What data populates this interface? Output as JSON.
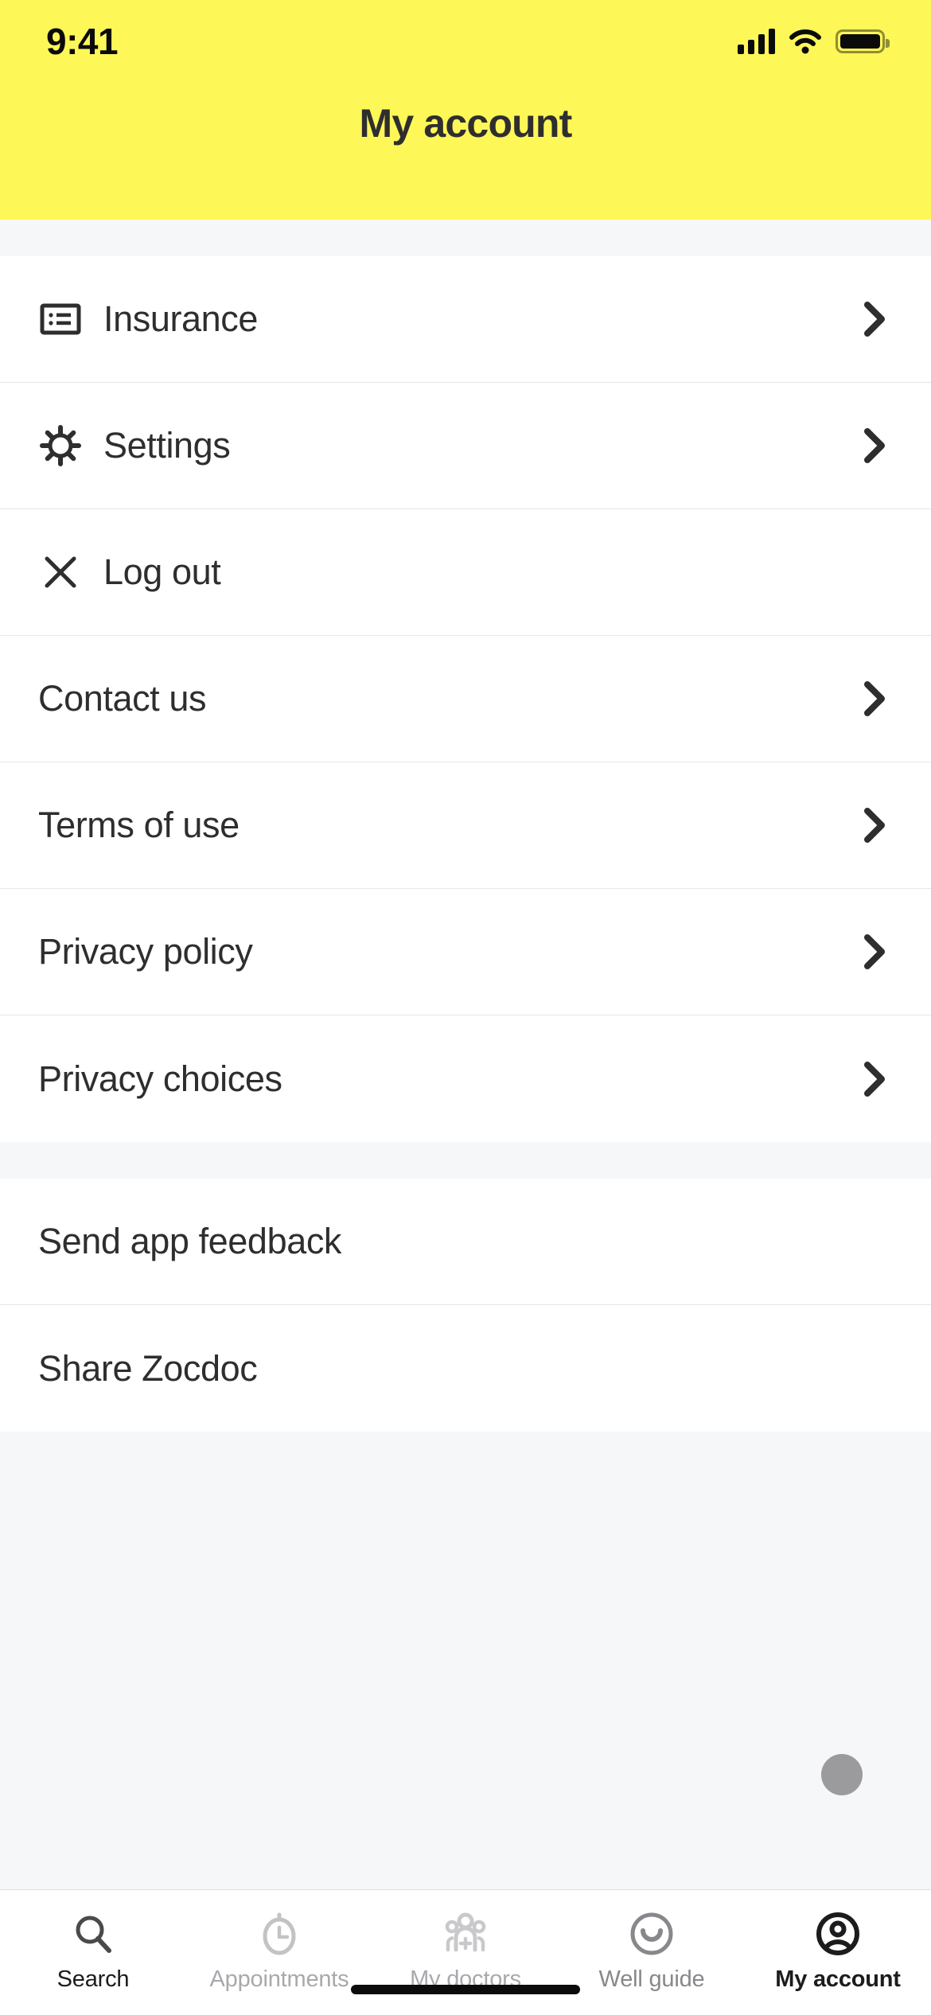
{
  "status_bar": {
    "time": "9:41",
    "icons": [
      "cellular-signal-icon",
      "wifi-icon",
      "battery-icon"
    ]
  },
  "header": {
    "title": "My account",
    "background_color": "#FDF758"
  },
  "menu_groups": [
    {
      "items": [
        {
          "label": "Insurance",
          "icon": "insurance-card-icon",
          "chevron": true
        },
        {
          "label": "Settings",
          "icon": "gear-icon",
          "chevron": true
        },
        {
          "label": "Log out",
          "icon": "close-x-icon",
          "chevron": false
        },
        {
          "label": "Contact us",
          "icon": "",
          "chevron": true
        },
        {
          "label": "Terms of use",
          "icon": "",
          "chevron": true
        },
        {
          "label": "Privacy policy",
          "icon": "",
          "chevron": true
        },
        {
          "label": "Privacy choices",
          "icon": "",
          "chevron": true
        }
      ]
    },
    {
      "items": [
        {
          "label": "Send app feedback",
          "icon": "",
          "chevron": false
        },
        {
          "label": "Share Zocdoc",
          "icon": "",
          "chevron": false
        }
      ]
    }
  ],
  "scroll_indicator": {
    "name": "floating-scroll-dot",
    "color": "#9B9B9E"
  },
  "tab_bar": {
    "tabs": [
      {
        "label": "Search",
        "icon": "search-icon",
        "active": true
      },
      {
        "label": "Appointments",
        "icon": "clock-icon",
        "active": false
      },
      {
        "label": "My doctors",
        "icon": "doctors-group-icon",
        "active": false
      },
      {
        "label": "Well guide",
        "icon": "smiley-face-icon",
        "active": false
      },
      {
        "label": "My account",
        "icon": "user-circle-icon",
        "active": true
      }
    ]
  },
  "colors": {
    "accent_yellow": "#FDF758",
    "text_dark": "#2F2E2E",
    "text_muted": "#A9A9AD",
    "page_bg": "#F6F7F9",
    "card_bg": "#FFFFFF",
    "divider": "#E6E7E9"
  }
}
